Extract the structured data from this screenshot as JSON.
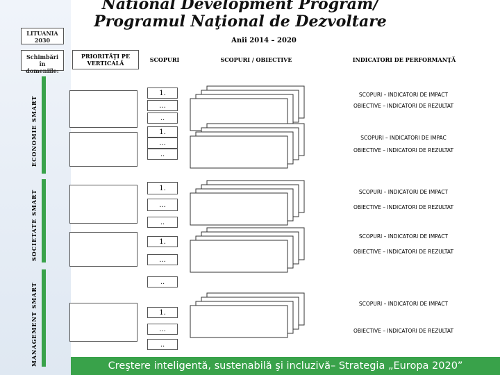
{
  "title": "National Development Program/ Programul Naţional de Dezvoltare",
  "country": "LITUANIA",
  "year": "2030",
  "years_range": "Anii 2014 – 2020",
  "changes_label": "Schimbări în domeniile:",
  "headers": {
    "priorities": "PRIORITĂŢI PE VERTICALĂ",
    "goals": "SCOPURI",
    "goals_objectives": "SCOPURI / OBIECTIVE",
    "indicators": "INDICATORI DE PERFORMANŢĂ"
  },
  "sections": [
    {
      "label": "ECONOMIE SMART"
    },
    {
      "label": "SOCIETATE SMART"
    },
    {
      "label": "MANAGEMENT SMART"
    }
  ],
  "goal_items": {
    "one": "1.",
    "ellipsis": "...",
    "dots": ".."
  },
  "indicators": [
    "SCOPURI – INDICATORI DE IMPACT",
    "OBIECTIVE – INDICATORI DE REZULTAT",
    "SCOPURI – INDICATORI DE IMPAC",
    "OBIECTIVE – INDICATORI DE REZULTAT",
    "SCOPURI – INDICATORI DE IMPACT",
    "OBIECTIVE – INDICATORI DE REZULTAT",
    "SCOPURI – INDICATORI DE IMPACT",
    "OBIECTIVE – INDICATORI DE REZULTAT",
    "SCOPURI – INDICATORI DE IMPACT",
    "OBIECTIVE – INDICATORI DE REZULTAT"
  ],
  "banner": "Creştere inteligentă, sustenabilă şi incluzivă– Strategia „Europa 2020”",
  "colors": {
    "accent_green": "#39a24a",
    "sidebar_bg": "#e6edf5"
  }
}
